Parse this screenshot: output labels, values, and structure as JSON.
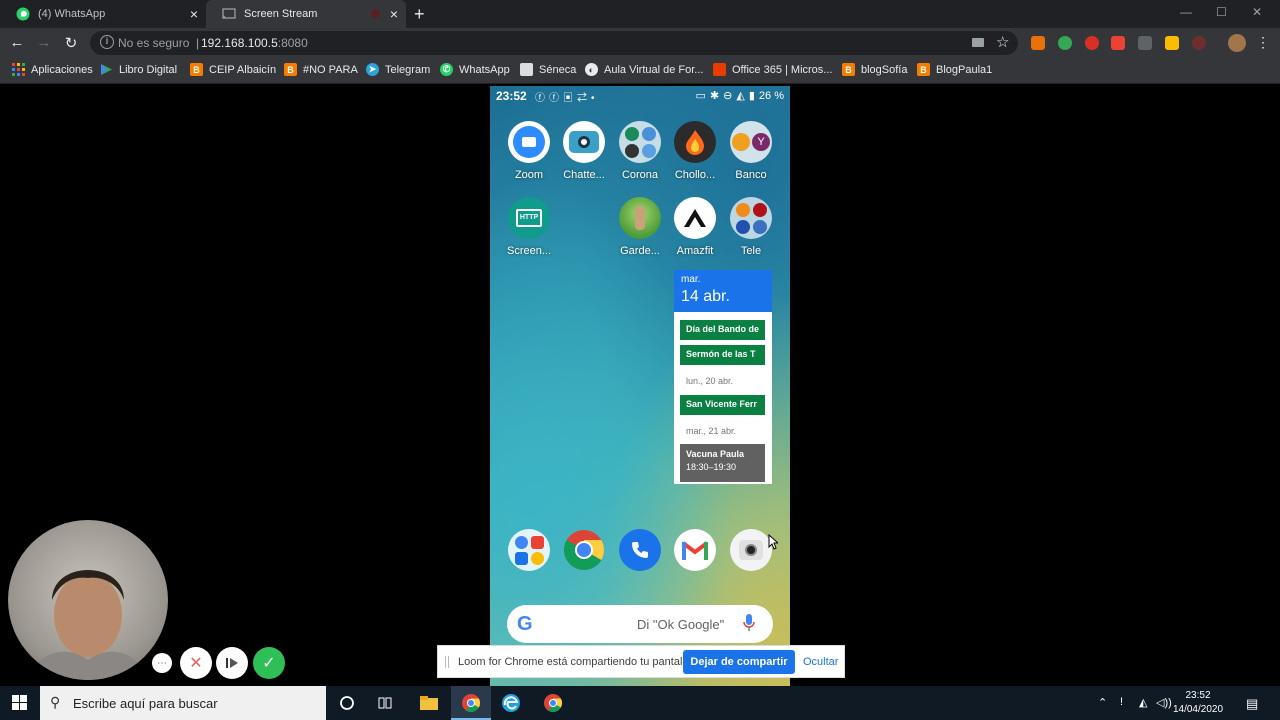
{
  "tabs": [
    {
      "label": "(4) WhatsApp",
      "active": false
    },
    {
      "label": "Screen Stream",
      "active": true
    }
  ],
  "omnibox": {
    "security": "No es seguro",
    "host": "192.168.100.5",
    "port": ":8080"
  },
  "bookmarks": [
    {
      "label": "Aplicaciones",
      "icon": "apps-grid-icon",
      "color": "#ea4335"
    },
    {
      "label": "Libro Digital",
      "icon": "play-store-icon",
      "color": "#34a853"
    },
    {
      "label": "CEIP Albaicín",
      "icon": "blogger-icon",
      "color": "#f57d00"
    },
    {
      "label": "#NO PARA",
      "icon": "blogger-icon",
      "color": "#f57d00"
    },
    {
      "label": "Telegram",
      "icon": "telegram-icon",
      "color": "#2aa3df"
    },
    {
      "label": "WhatsApp",
      "icon": "whatsapp-icon",
      "color": "#25d366"
    },
    {
      "label": "Séneca",
      "icon": "page-icon",
      "color": "#dadce0"
    },
    {
      "label": "Aula Virtual de For...",
      "icon": "globe-icon",
      "color": "#e8eaed"
    },
    {
      "label": "Office 365 | Micros...",
      "icon": "office-icon",
      "color": "#eb3c00"
    },
    {
      "label": "blogSofía",
      "icon": "blogger-icon",
      "color": "#f57d00"
    },
    {
      "label": "BlogPaula1",
      "icon": "blogger-icon",
      "color": "#f57d00"
    }
  ],
  "phone": {
    "time": "23:52",
    "battery": "26 %",
    "apps_row1": [
      {
        "label": "Zoom",
        "icon": "zoom-icon"
      },
      {
        "label": "Chatte...",
        "icon": "camera-app-icon"
      },
      {
        "label": "Corona",
        "icon": "folder-icon"
      },
      {
        "label": "Chollo...",
        "icon": "flame-icon"
      },
      {
        "label": "Banco",
        "icon": "bank-folder-icon"
      }
    ],
    "apps_row2": [
      {
        "label": "Screen...",
        "icon": "http-stream-icon"
      },
      {
        "label": "Garde...",
        "icon": "garden-icon"
      },
      {
        "label": "Amazfit",
        "icon": "amazfit-icon"
      },
      {
        "label": "Tele",
        "icon": "tele-folder-icon"
      }
    ],
    "dock": [
      {
        "icon": "google-folder-icon"
      },
      {
        "icon": "chrome-icon"
      },
      {
        "icon": "phone-icon"
      },
      {
        "icon": "gmail-icon"
      },
      {
        "icon": "camera-icon"
      }
    ],
    "search_hint": "Di \"Ok Google\""
  },
  "calendar": {
    "day_of_week": "mar.",
    "date": "14 abr.",
    "events": [
      {
        "title": "Día del Bando de"
      },
      {
        "title": "Sermón de las T"
      },
      {
        "day": "lun., 20 abr."
      },
      {
        "title": "San Vicente Ferr"
      },
      {
        "day": "mar., 21 abr."
      },
      {
        "title": "Vacuna Paula",
        "time": "18:30–19:30"
      }
    ]
  },
  "sharebar": {
    "message": "Loom for Chrome está compartiendo tu pantalla.",
    "stop_label": "Dejar de compartir",
    "hide_label": "Ocultar"
  },
  "taskbar": {
    "search_placeholder": "Escribe aquí para buscar",
    "time": "23:52",
    "date": "14/04/2020"
  },
  "colors": {
    "chrome_dark": "#202124",
    "chrome_toolbar": "#35363a",
    "calendar_blue": "#1a73e8",
    "event_green": "#0b8043",
    "taskbar": "#101a24"
  }
}
